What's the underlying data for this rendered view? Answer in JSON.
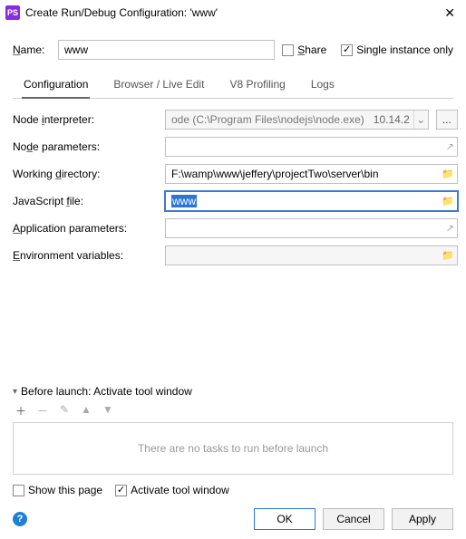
{
  "window": {
    "title": "Create Run/Debug Configuration: 'www'"
  },
  "name": {
    "label": "Name:",
    "value": "www"
  },
  "options": {
    "share": {
      "label": "Share",
      "checked": false
    },
    "single_instance": {
      "label": "Single instance only",
      "checked": true
    }
  },
  "tabs": {
    "configuration": "Configuration",
    "browser": "Browser / Live Edit",
    "v8": "V8 Profiling",
    "logs": "Logs"
  },
  "form": {
    "node_interpreter": {
      "label": "Node interpreter:",
      "value": "ode (C:\\Program Files\\nodejs\\node.exe)",
      "version": "10.14.2"
    },
    "node_parameters": {
      "label": "Node parameters:",
      "value": ""
    },
    "working_directory": {
      "label": "Working directory:",
      "value": "F:\\wamp\\www\\jeffery\\projectTwo\\server\\bin"
    },
    "javascript_file": {
      "label": "JavaScript file:",
      "value": "www"
    },
    "application_parameters": {
      "label": "Application parameters:",
      "value": ""
    },
    "environment_variables": {
      "label": "Environment variables:",
      "value": ""
    }
  },
  "before_launch": {
    "title": "Before launch: Activate tool window",
    "empty_text": "There are no tasks to run before launch",
    "show_this_page": {
      "label": "Show this page",
      "checked": false
    },
    "activate_tool_window": {
      "label": "Activate tool window",
      "checked": true
    }
  },
  "buttons": {
    "ok": "OK",
    "cancel": "Cancel",
    "apply": "Apply"
  },
  "ellipsis": "..."
}
